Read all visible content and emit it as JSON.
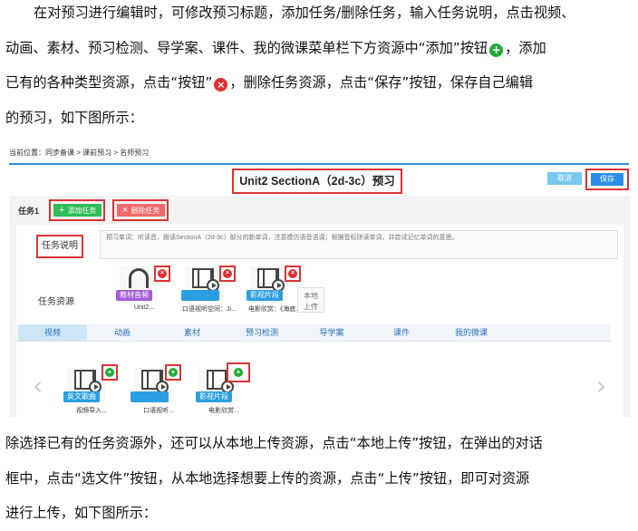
{
  "intro": {
    "line1": "在对预习进行编辑时，可修改预习标题，添加任务/删除任务，输入任务说明，点击视频、",
    "line2_a": "动画、素材、预习检测、导学案、课件、我的微课菜单栏下方资源中“添加”按钮",
    "line2_b": "，添加",
    "line3_a": "已有的各种类型资源，点击“按钮”",
    "line3_b": "，删除任务资源，点击“保存”按钮，保存自己编辑",
    "line4": "的预习，如下图所示："
  },
  "screenshot": {
    "breadcrumb": "当前位置：同步备课  >  课前预习  >  名师预习",
    "title": "Unit2 SectionA（2d-3c）预习",
    "cancel_label": "取消",
    "save_label": "保存",
    "task_label": "任务1",
    "add_task_label": "添加任务",
    "delete_task_label": "删除任务",
    "desc_label": "任务说明",
    "desc_text": "预习单词：听读音，跟读SectionA（2d-3c）部分的新单词，注意模仿语音语调；根据音标拼读单词，并尝试记忆单词的意思。",
    "resource_label": "任务资源",
    "local_upload_1": "本地",
    "local_upload_2": "上传",
    "resources": [
      {
        "tag": "教材音频",
        "caption": "Unit2..."
      },
      {
        "tag": "",
        "caption": "口语视听空间：Ji..."
      },
      {
        "tag": "影视片段",
        "caption": "电影欣赏：《海底..."
      }
    ],
    "tabs": [
      "视频",
      "动画",
      "素材",
      "预习检测",
      "导学案",
      "课件",
      "我的微课"
    ],
    "library": [
      {
        "tag": "英文歌曲",
        "caption": "视频导入..."
      },
      {
        "tag": "",
        "caption": "口语视听..."
      },
      {
        "tag": "影视片段",
        "caption": "电影欣赏..."
      }
    ],
    "add_symbol": "+",
    "remove_symbol": "×",
    "prev_arrow": "‹",
    "next_arrow": "›"
  },
  "outro": {
    "line1": "除选择已有的任务资源外，还可以从本地上传资源，点击“本地上传”按钮，在弹出的对话",
    "line2": "框中，点击“选文件”按钮，从本地选择想要上传的资源，点击“上传”按钮，即可对资源",
    "line3": "进行上传，如下图所示："
  },
  "colors": {
    "add_green": "#22a83a",
    "remove_red": "#e03030",
    "highlight_red": "#dd3333",
    "brand_blue": "#2a8ee8"
  }
}
